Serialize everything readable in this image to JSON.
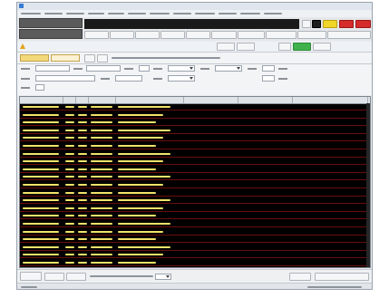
{
  "window": {
    "title": "",
    "app_icon": "app-icon"
  },
  "menubar": {
    "items": [
      "",
      "",
      "",
      "",
      "",
      "",
      "",
      "",
      "",
      "",
      "",
      ""
    ]
  },
  "toolbar": {
    "mode_label_top": "",
    "mode_label_bottom": "",
    "status_text": "",
    "buttons": [
      "",
      "",
      "",
      "",
      "",
      "",
      "",
      "",
      "",
      ""
    ],
    "right_buttons": [
      "",
      "",
      "",
      ""
    ]
  },
  "page": {
    "title": "",
    "warning_icon": "warning-icon",
    "header_buttons": [
      "",
      "",
      "",
      ""
    ]
  },
  "filters": {
    "tabs": [
      "",
      ""
    ],
    "nav_buttons": [
      "",
      ""
    ],
    "date_range_text": "",
    "fields": [
      "",
      "",
      "",
      "",
      "",
      "",
      "",
      "",
      ""
    ],
    "inputs": [
      "",
      "",
      "",
      "",
      "",
      "",
      "",
      ""
    ],
    "selects": [
      "",
      "",
      "",
      "",
      "",
      ""
    ]
  },
  "table": {
    "columns": [
      "",
      "",
      "",
      "",
      "",
      "",
      "",
      ""
    ],
    "row_count": 21,
    "color_accent": "#f2e36a",
    "row_bg": "#000000",
    "row_border": "#6a0d0d"
  },
  "bottom": {
    "buttons": [
      "",
      "",
      "",
      "",
      "",
      ""
    ],
    "info": ""
  },
  "statusbar": {
    "left": "",
    "right": ""
  },
  "colors": {
    "yellow": "#f1d62a",
    "red": "#d62b2b",
    "green": "#3fb24c",
    "dark": "#1a1a1a"
  }
}
